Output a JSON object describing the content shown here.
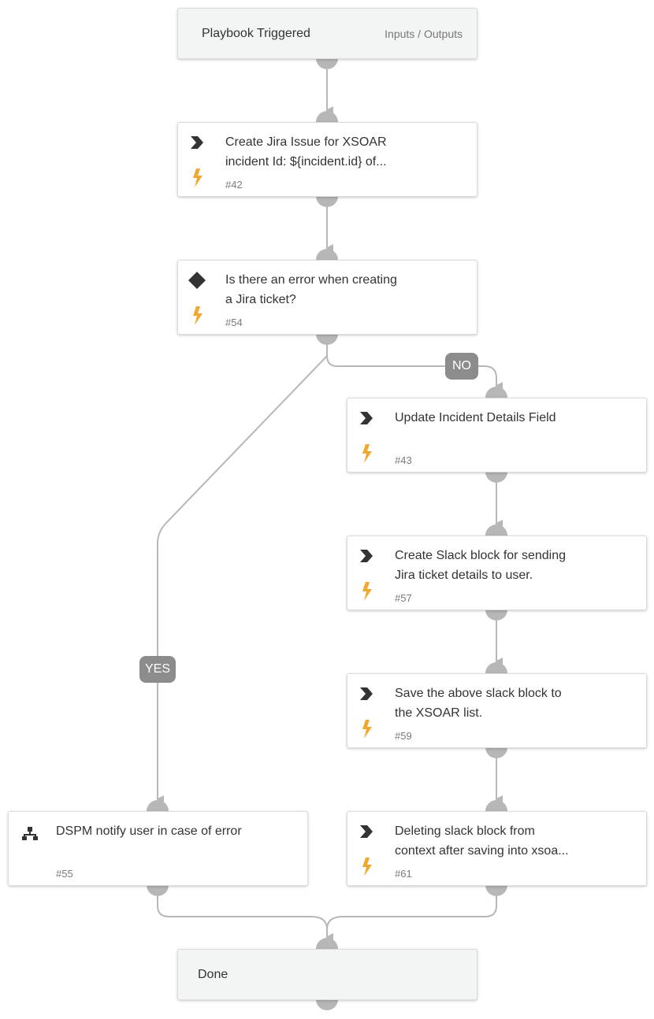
{
  "diagram": {
    "colors": {
      "edge": "#b7b7b7",
      "port": "#b7b7b7",
      "bolt": "#f0a830",
      "icon": "#333333",
      "badge": "#8c8c8c"
    },
    "start": {
      "title": "Playbook Triggered",
      "io_link": "Inputs / Outputs"
    },
    "tasks": [
      {
        "id": "#42",
        "type": "chevron-icon",
        "title_line1": "Create Jira Issue for XSOAR",
        "title_line2": "incident Id: ${incident.id} of...",
        "automated": true
      },
      {
        "id": "#54",
        "type": "diamond-icon",
        "title_line1": "Is there an error when creating",
        "title_line2": "a Jira ticket?",
        "automated": true
      },
      {
        "id": "#43",
        "type": "chevron-icon",
        "title_line1": "Update Incident Details Field",
        "title_line2": "",
        "automated": true
      },
      {
        "id": "#57",
        "type": "chevron-icon",
        "title_line1": "Create Slack block for sending",
        "title_line2": "Jira ticket details to user.",
        "automated": true
      },
      {
        "id": "#59",
        "type": "chevron-icon",
        "title_line1": "Save the above slack block to",
        "title_line2": "the XSOAR list.",
        "automated": true
      },
      {
        "id": "#55",
        "type": "sub-playbook-icon",
        "title_line1": "DSPM notify user in case of error",
        "title_line2": "",
        "automated": false
      },
      {
        "id": "#61",
        "type": "chevron-icon",
        "title_line1": "Deleting slack block from",
        "title_line2": "context after saving into xsoa...",
        "automated": true
      }
    ],
    "branch_labels": {
      "no": "NO",
      "yes": "YES"
    },
    "end": {
      "title": "Done"
    }
  }
}
